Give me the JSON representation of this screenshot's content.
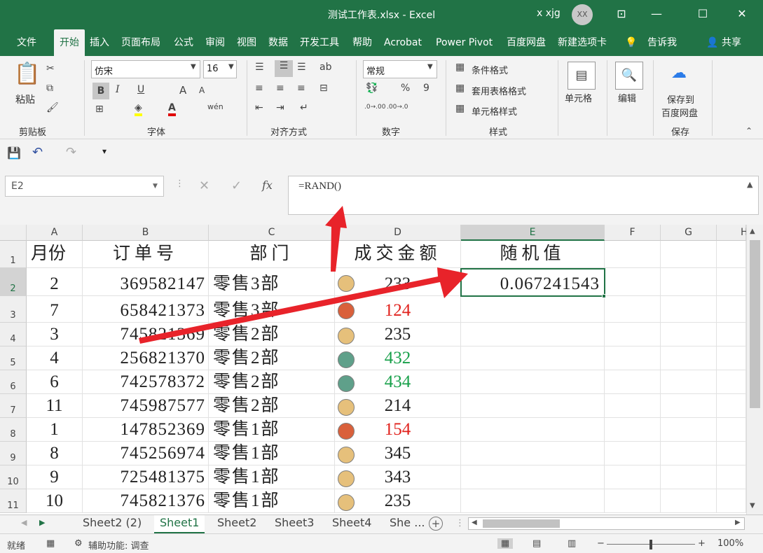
{
  "titlebar": {
    "title": "测试工作表.xlsx  -  Excel",
    "user": "x xjg",
    "avatar": "XX"
  },
  "menu": [
    "文件",
    "开始",
    "插入",
    "页面布局",
    "公式",
    "审阅",
    "视图",
    "数据",
    "开发工具",
    "帮助",
    "Acrobat",
    "Power Pivot",
    "百度网盘",
    "新建选项卡"
  ],
  "menu_extra": {
    "tell": "告诉我",
    "share": "共享"
  },
  "ribbon": {
    "clipboard": {
      "paste": "粘贴",
      "label": "剪贴板"
    },
    "font": {
      "name": "仿宋",
      "size": "16",
      "label": "字体",
      "bold": "B",
      "italic": "I",
      "underline": "U",
      "grow": "A",
      "shrink": "A",
      "color_a": "A",
      "pinyin": "wén"
    },
    "align": {
      "label": "对齐方式"
    },
    "number": {
      "format": "常规",
      "label": "数字",
      "percent": "%",
      "comma": "9",
      "inc": ".0→.00",
      "dec": ".00→.0"
    },
    "styles": {
      "cond": "条件格式",
      "table": "套用表格格式",
      "cell": "单元格样式",
      "label": "样式"
    },
    "cells": {
      "label": "单元格"
    },
    "edit": {
      "label": "编辑"
    },
    "save": {
      "line1": "保存到",
      "line2": "百度网盘",
      "label": "保存"
    }
  },
  "formula_bar": {
    "name_box": "E2",
    "formula": "=RAND()",
    "fx": "fx"
  },
  "columns": [
    "A",
    "B",
    "C",
    "D",
    "E",
    "F",
    "G",
    "H"
  ],
  "header_row": {
    "row_num": "1",
    "month": "月份",
    "order": "订单号",
    "dept": "部门",
    "amount": "成交金额",
    "random": "随机值"
  },
  "rows": [
    {
      "row_num": "2",
      "month": "2",
      "order": "369582147",
      "dept": "零售3部",
      "amount": "233",
      "random": "0.067241543",
      "dot": "#e6c07b",
      "color": "#222222"
    },
    {
      "row_num": "3",
      "month": "7",
      "order": "658421373",
      "dept": "零售3部",
      "amount": "124",
      "random": "",
      "dot": "#d9603b",
      "color": "#e0201b"
    },
    {
      "row_num": "4",
      "month": "3",
      "order": "745821369",
      "dept": "零售2部",
      "amount": "235",
      "random": "",
      "dot": "#e6c07b",
      "color": "#222222"
    },
    {
      "row_num": "5",
      "month": "4",
      "order": "256821370",
      "dept": "零售2部",
      "amount": "432",
      "random": "",
      "dot": "#5fa08a",
      "color": "#18a04a"
    },
    {
      "row_num": "6",
      "month": "6",
      "order": "742578372",
      "dept": "零售2部",
      "amount": "434",
      "random": "",
      "dot": "#5fa08a",
      "color": "#18a04a"
    },
    {
      "row_num": "7",
      "month": "11",
      "order": "745987577",
      "dept": "零售2部",
      "amount": "214",
      "random": "",
      "dot": "#e6c07b",
      "color": "#222222"
    },
    {
      "row_num": "8",
      "month": "1",
      "order": "147852369",
      "dept": "零售1部",
      "amount": "154",
      "random": "",
      "dot": "#d9603b",
      "color": "#e0201b"
    },
    {
      "row_num": "9",
      "month": "8",
      "order": "745256974",
      "dept": "零售1部",
      "amount": "345",
      "random": "",
      "dot": "#e6c07b",
      "color": "#222222"
    },
    {
      "row_num": "10",
      "month": "9",
      "order": "725481375",
      "dept": "零售1部",
      "amount": "343",
      "random": "",
      "dot": "#e6c07b",
      "color": "#222222"
    },
    {
      "row_num": "11",
      "month": "10",
      "order": "745821376",
      "dept": "零售1部",
      "amount": "235",
      "random": "",
      "dot": "#e6c07b",
      "color": "#222222"
    }
  ],
  "sheets": [
    "Sheet2 (2)",
    "Sheet1",
    "Sheet2",
    "Sheet3",
    "Sheet4",
    "She ..."
  ],
  "active_sheet": "Sheet1",
  "status": {
    "ready": "就绪",
    "accessibility": "辅助功能: 调查",
    "zoom": "100%"
  },
  "colors": {
    "accent": "#217346",
    "arrow": "#e8232a"
  }
}
